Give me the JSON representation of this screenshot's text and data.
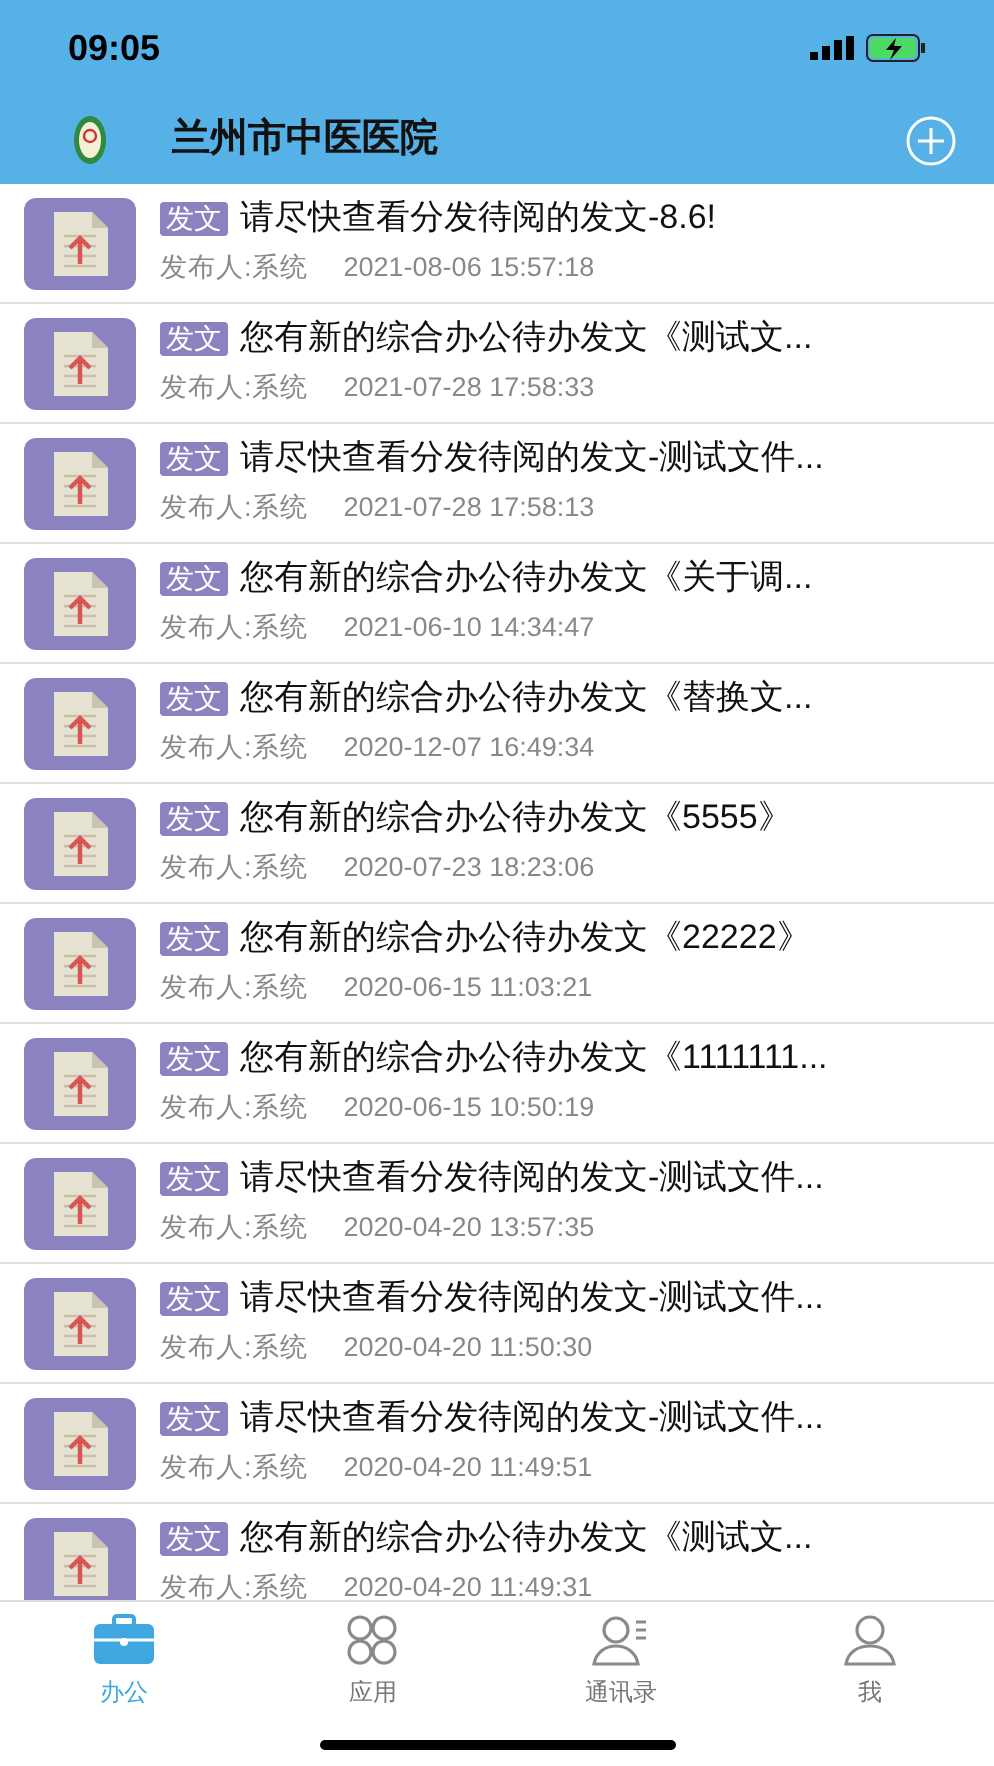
{
  "status_bar": {
    "time": "09:05"
  },
  "header": {
    "title": "兰州市中医医院"
  },
  "messages": [
    {
      "tag": "发文",
      "title": "请尽快查看分发待阅的发文-8.6!",
      "publisher": "发布人:系统",
      "time": "2021-08-06 15:57:18"
    },
    {
      "tag": "发文",
      "title": "您有新的综合办公待办发文《测试文...",
      "publisher": "发布人:系统",
      "time": "2021-07-28 17:58:33"
    },
    {
      "tag": "发文",
      "title": "请尽快查看分发待阅的发文-测试文件...",
      "publisher": "发布人:系统",
      "time": "2021-07-28 17:58:13"
    },
    {
      "tag": "发文",
      "title": "您有新的综合办公待办发文《关于调...",
      "publisher": "发布人:系统",
      "time": "2021-06-10 14:34:47"
    },
    {
      "tag": "发文",
      "title": "您有新的综合办公待办发文《替换文...",
      "publisher": "发布人:系统",
      "time": "2020-12-07 16:49:34"
    },
    {
      "tag": "发文",
      "title": "您有新的综合办公待办发文《5555》",
      "publisher": "发布人:系统",
      "time": "2020-07-23 18:23:06"
    },
    {
      "tag": "发文",
      "title": "您有新的综合办公待办发文《22222》",
      "publisher": "发布人:系统",
      "time": "2020-06-15 11:03:21"
    },
    {
      "tag": "发文",
      "title": "您有新的综合办公待办发文《1111111...",
      "publisher": "发布人:系统",
      "time": "2020-06-15 10:50:19"
    },
    {
      "tag": "发文",
      "title": "请尽快查看分发待阅的发文-测试文件...",
      "publisher": "发布人:系统",
      "time": "2020-04-20 13:57:35"
    },
    {
      "tag": "发文",
      "title": "请尽快查看分发待阅的发文-测试文件...",
      "publisher": "发布人:系统",
      "time": "2020-04-20 11:50:30"
    },
    {
      "tag": "发文",
      "title": "请尽快查看分发待阅的发文-测试文件...",
      "publisher": "发布人:系统",
      "time": "2020-04-20 11:49:51"
    },
    {
      "tag": "发文",
      "title": "您有新的综合办公待办发文《测试文...",
      "publisher": "发布人:系统",
      "time": "2020-04-20 11:49:31"
    }
  ],
  "tab_bar": [
    {
      "kind": "office",
      "label": "办公",
      "selected": true
    },
    {
      "kind": "apps",
      "label": "应用",
      "selected": false
    },
    {
      "kind": "contacts",
      "label": "通讯录",
      "selected": false
    },
    {
      "kind": "me",
      "label": "我",
      "selected": false
    }
  ]
}
